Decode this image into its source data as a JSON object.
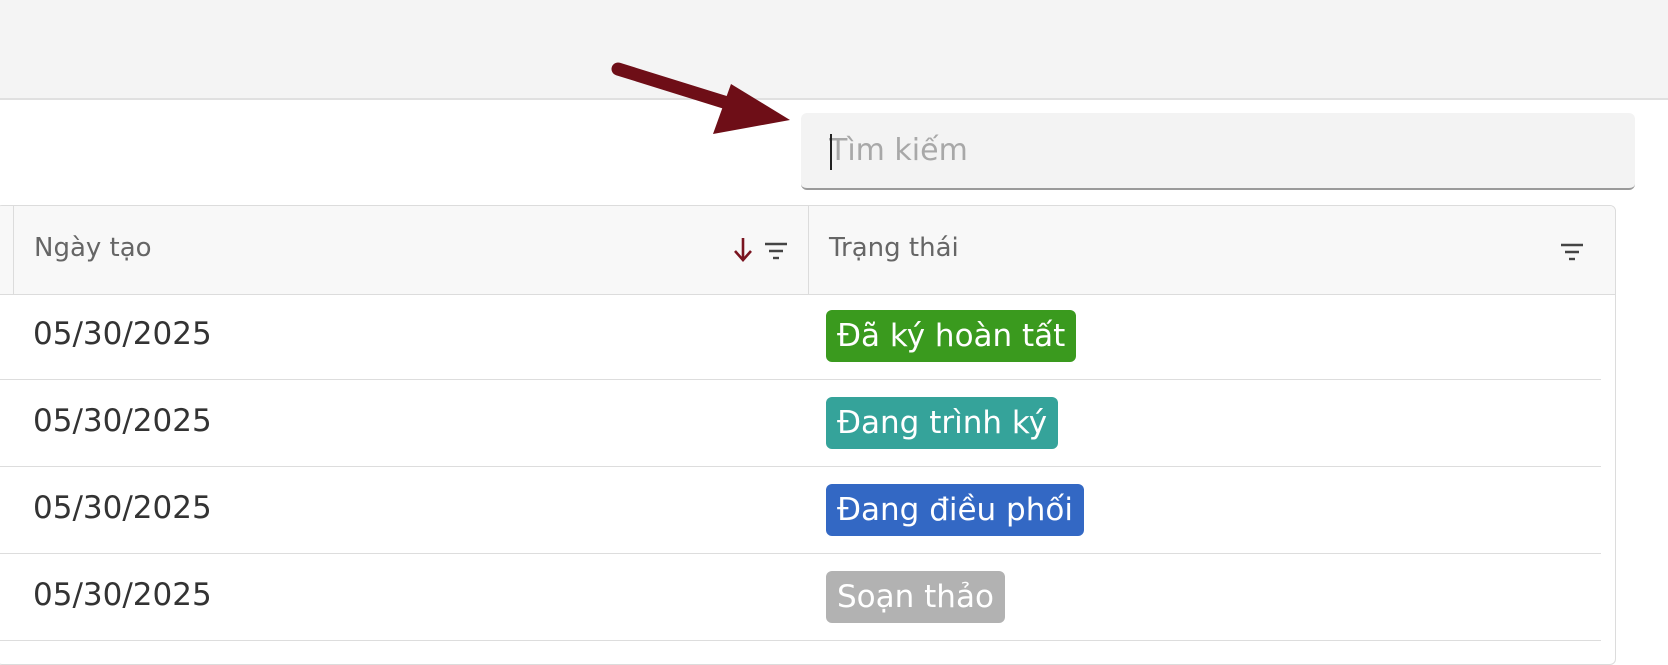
{
  "search": {
    "placeholder": "Tìm kiếm",
    "value": ""
  },
  "table": {
    "columns": [
      {
        "label": "Ngày tạo",
        "sorted": "descending",
        "filterable": true
      },
      {
        "label": "Trạng thái",
        "filterable": true
      }
    ],
    "rows": [
      {
        "created_date": "05/30/2025",
        "status": "Đã ký hoàn tất",
        "status_color": "#3a9a1e"
      },
      {
        "created_date": "05/30/2025",
        "status": "Đang trình ký",
        "status_color": "#35a39a"
      },
      {
        "created_date": "05/30/2025",
        "status": "Đang điều phối",
        "status_color": "#3368c4"
      },
      {
        "created_date": "05/30/2025",
        "status": "Soạn thảo",
        "status_color": "#b2b2b2"
      }
    ]
  },
  "icons": {
    "sort": "arrow-down-icon",
    "filter": "filter-icon"
  },
  "colors": {
    "sort_arrow": "#7a1420",
    "annotation_arrow": "#6e0e17",
    "header_background": "#f8f8f8",
    "top_bar_background": "#f4f4f4"
  },
  "annotation": {
    "type": "arrow",
    "points_to": "search-input"
  }
}
